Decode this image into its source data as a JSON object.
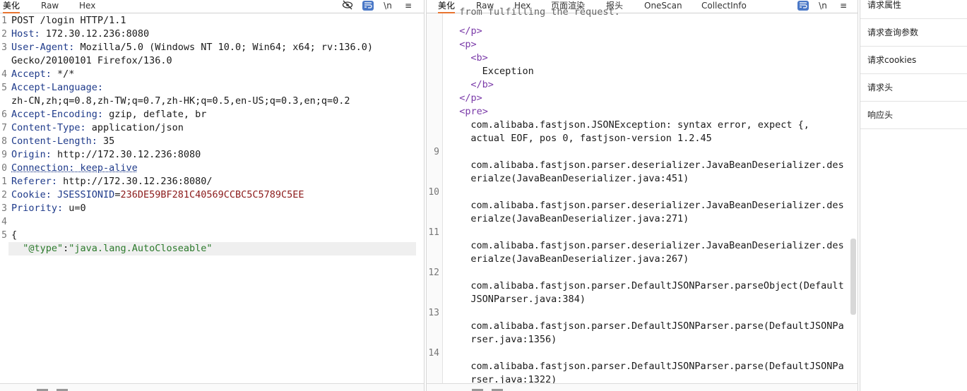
{
  "request_pane": {
    "tabs": [
      "美化",
      "Raw",
      "Hex"
    ],
    "lines": [
      {
        "num": "1",
        "parts": [
          {
            "t": "POST /login HTTP/1.1",
            "c": "v"
          }
        ]
      },
      {
        "num": "2",
        "parts": [
          {
            "t": "Host: ",
            "c": "k"
          },
          {
            "t": "172.30.12.236:8080",
            "c": "v"
          }
        ]
      },
      {
        "num": "3",
        "parts": [
          {
            "t": "User-Agent: ",
            "c": "k"
          },
          {
            "t": "Mozilla/5.0 (Windows NT 10.0; Win64; x64; rv:136.0)",
            "c": "v"
          }
        ]
      },
      {
        "num": "",
        "parts": [
          {
            "t": "Gecko/20100101 Firefox/136.0",
            "c": "v"
          }
        ]
      },
      {
        "num": "4",
        "parts": [
          {
            "t": "Accept: ",
            "c": "k"
          },
          {
            "t": "*/*",
            "c": "v"
          }
        ]
      },
      {
        "num": "5",
        "parts": [
          {
            "t": "Accept-Language:",
            "c": "k"
          }
        ]
      },
      {
        "num": "",
        "parts": [
          {
            "t": "zh-CN,zh;q=0.8,zh-TW;q=0.7,zh-HK;q=0.5,en-US;q=0.3,en;q=0.2",
            "c": "v"
          }
        ]
      },
      {
        "num": "6",
        "parts": [
          {
            "t": "Accept-Encoding: ",
            "c": "k"
          },
          {
            "t": "gzip, deflate, br",
            "c": "v"
          }
        ]
      },
      {
        "num": "7",
        "parts": [
          {
            "t": "Content-Type: ",
            "c": "k"
          },
          {
            "t": "application/json",
            "c": "v"
          }
        ]
      },
      {
        "num": "8",
        "parts": [
          {
            "t": "Content-Length: ",
            "c": "k"
          },
          {
            "t": "35",
            "c": "v"
          }
        ]
      },
      {
        "num": "9",
        "parts": [
          {
            "t": "Origin: ",
            "c": "k"
          },
          {
            "t": "http://172.30.12.236:8080",
            "c": "v"
          }
        ]
      },
      {
        "num": "0",
        "parts": [
          {
            "t": "Connection: keep-alive",
            "c": "k dot"
          }
        ]
      },
      {
        "num": "1",
        "parts": [
          {
            "t": "Referer: ",
            "c": "k"
          },
          {
            "t": "http://172.30.12.236:8080/",
            "c": "v"
          }
        ]
      },
      {
        "num": "2",
        "parts": [
          {
            "t": "Cookie: ",
            "c": "k"
          },
          {
            "t": "JSESSIONID",
            "c": "k"
          },
          {
            "t": "=",
            "c": "v"
          },
          {
            "t": "236DE59BF281C40569CCBC5C5789C5EE",
            "c": "ck"
          }
        ]
      },
      {
        "num": "3",
        "parts": [
          {
            "t": "Priority: ",
            "c": "k"
          },
          {
            "t": "u=0",
            "c": "v"
          }
        ]
      },
      {
        "num": "4",
        "parts": []
      },
      {
        "num": "5",
        "parts": [
          {
            "t": "{",
            "c": "v"
          }
        ]
      },
      {
        "num": "",
        "parts": [
          {
            "t": "  \"@type\"",
            "c": "jk"
          },
          {
            "t": ":",
            "c": "v"
          },
          {
            "t": "\"java.lang.AutoCloseable\"",
            "c": "js"
          }
        ],
        "highlight": true
      }
    ]
  },
  "response_pane": {
    "tabs": [
      "美化",
      "Raw",
      "Hex",
      "页面渲染",
      "报头",
      "OneScan",
      "CollectInfo"
    ],
    "gutter_numbers": [
      {
        "num": "9",
        "row": 10
      },
      {
        "num": "10",
        "row": 13
      },
      {
        "num": "11",
        "row": 16
      },
      {
        "num": "12",
        "row": 19
      },
      {
        "num": "13",
        "row": 22
      },
      {
        "num": "14",
        "row": 25
      }
    ],
    "lines": [
      {
        "row": 0,
        "indent": 2,
        "t": "from fulfilling the request.",
        "c": "v",
        "partial": true
      },
      {
        "row": 1,
        "indent": 2,
        "t": "</p>",
        "c": "tag"
      },
      {
        "row": 2,
        "indent": 2,
        "t": "<p>",
        "c": "tag"
      },
      {
        "row": 3,
        "indent": 4,
        "t": "<b>",
        "c": "tag"
      },
      {
        "row": 4,
        "indent": 6,
        "t": "Exception",
        "c": "v"
      },
      {
        "row": 5,
        "indent": 4,
        "t": "</b>",
        "c": "tag"
      },
      {
        "row": 6,
        "indent": 2,
        "t": "</p>",
        "c": "tag"
      },
      {
        "row": 7,
        "indent": 2,
        "t": "<pre>",
        "c": "tag"
      },
      {
        "row": 8,
        "indent": 4,
        "t": "com.alibaba.fastjson.JSONException: syntax error, expect {,",
        "c": "v"
      },
      {
        "row": 9,
        "indent": 4,
        "t": "actual EOF, pos 0, fastjson-version 1.2.45",
        "c": "v"
      },
      {
        "row": 11,
        "indent": 4,
        "t": "com.alibaba.fastjson.parser.deserializer.JavaBeanDeserializer.des",
        "c": "v"
      },
      {
        "row": 12,
        "indent": 4,
        "t": "erialze(JavaBeanDeserializer.java:451)",
        "c": "v"
      },
      {
        "row": 14,
        "indent": 4,
        "t": "com.alibaba.fastjson.parser.deserializer.JavaBeanDeserializer.des",
        "c": "v"
      },
      {
        "row": 15,
        "indent": 4,
        "t": "erialze(JavaBeanDeserializer.java:271)",
        "c": "v"
      },
      {
        "row": 17,
        "indent": 4,
        "t": "com.alibaba.fastjson.parser.deserializer.JavaBeanDeserializer.des",
        "c": "v"
      },
      {
        "row": 18,
        "indent": 4,
        "t": "erialze(JavaBeanDeserializer.java:267)",
        "c": "v"
      },
      {
        "row": 20,
        "indent": 4,
        "t": "com.alibaba.fastjson.parser.DefaultJSONParser.parseObject(Default",
        "c": "v"
      },
      {
        "row": 21,
        "indent": 4,
        "t": "JSONParser.java:384)",
        "c": "v"
      },
      {
        "row": 23,
        "indent": 4,
        "t": "com.alibaba.fastjson.parser.DefaultJSONParser.parse(DefaultJSONPa",
        "c": "v"
      },
      {
        "row": 24,
        "indent": 4,
        "t": "rser.java:1356)",
        "c": "v"
      },
      {
        "row": 26,
        "indent": 4,
        "t": "com.alibaba.fastjson.parser.DefaultJSONParser.parse(DefaultJSONPa",
        "c": "v"
      },
      {
        "row": 27,
        "indent": 4,
        "t": "rser.java:1322)",
        "c": "v"
      }
    ]
  },
  "side_panel": {
    "items": [
      "请求属性",
      "请求查询参数",
      "请求cookies",
      "请求头",
      "响应头"
    ]
  },
  "icons": {
    "hide": "eye-off-icon",
    "wrap": "wrap-icon",
    "newline": "\\n",
    "menu": "≡"
  },
  "colors": {
    "accent": "#e8742f",
    "header_key": "#1e3a8a",
    "cookie_value": "#8b1a1a",
    "json_string": "#2c7a2c",
    "html_tag": "#7a3aa8"
  }
}
